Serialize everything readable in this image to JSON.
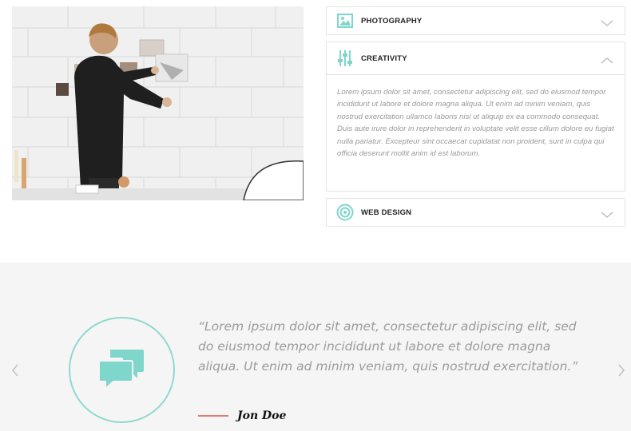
{
  "accordion": {
    "items": [
      {
        "title": "PHOTOGRAPHY",
        "icon": "image-icon",
        "state": "collapsed"
      },
      {
        "title": "CREATIVITY",
        "icon": "sliders-icon",
        "state": "expanded",
        "body": "Lorem ipsum dolor sit amet, consectetur adipiscing elit, sed do eiusmod tempor incididunt ut labore et dolore magna aliqua. Ut enim ad minim veniam, quis nostrud exercitation ullamco laboris nisi ut aliquip ex ea commodo consequat. Duis aute irure dolor in reprehenderit in voluptate velit esse cillum dolore eu fugiat nulla pariatur. Excepteur sint occaecat cupidatat non proident, sunt in culpa qui officia deserunt mollit anim id est laborum."
      },
      {
        "title": "WEB DESIGN",
        "icon": "target-icon",
        "state": "collapsed"
      }
    ]
  },
  "testimonial": {
    "quote": "“Lorem ipsum dolor sit amet, consectetur adipiscing elit, sed do eiusmod tempor incididunt ut labore et dolore magna aliqua. Ut enim ad minim veniam, quis nostrud exercitation.”",
    "author": "Jon Doe",
    "icon": "chat-bubbles-icon"
  },
  "colors": {
    "accent": "#7fd6cb",
    "author_line": "#e07a72",
    "section_bg": "#f5f5f5",
    "border": "#e4e4e4"
  }
}
